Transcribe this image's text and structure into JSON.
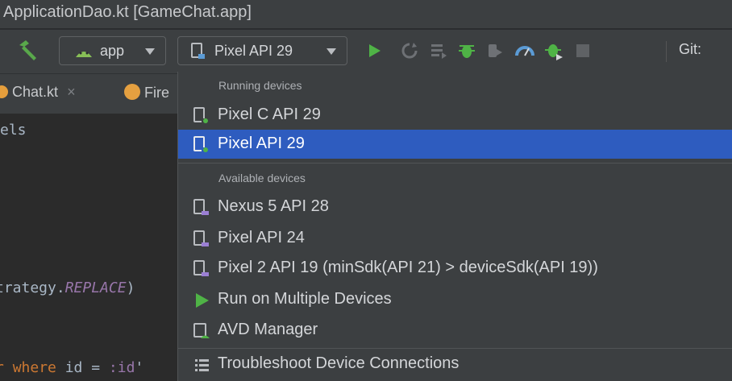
{
  "window": {
    "title": "ApplicationDao.kt [GameChat.app]"
  },
  "toolbar": {
    "build_icon": "hammer-icon",
    "app_config": "app",
    "device_selector": "Pixel API 29",
    "git_label": "Git:",
    "icons": [
      "run-icon",
      "apply-changes-icon",
      "apply-code-changes-icon",
      "debug-icon",
      "attach-debugger-icon",
      "profile-icon",
      "attach-process-icon",
      "stop-icon"
    ]
  },
  "tabs": [
    {
      "label": "Chat.kt",
      "close": "×"
    },
    {
      "label": "Fire"
    }
  ],
  "editor": {
    "lines": [
      {
        "text": "els"
      },
      {
        "text": "trategy.",
        "tail_italic": "REPLACE",
        "tail": ")"
      },
      {
        "kw1": "r ",
        "kw2": "where",
        "mid": " id = ",
        "param": ":id",
        "end": "'"
      }
    ]
  },
  "menu": {
    "running_header": "Running devices",
    "running": [
      {
        "label": "Pixel C API 29",
        "icon": "device-running-icon",
        "selected": false
      },
      {
        "label": "Pixel API 29",
        "icon": "device-running-icon",
        "selected": true
      }
    ],
    "available_header": "Available devices",
    "available": [
      {
        "label": "Nexus 5 API 28",
        "icon": "device-icon"
      },
      {
        "label": "Pixel API 24",
        "icon": "device-icon"
      },
      {
        "label": "Pixel 2 API 19 (minSdk(API 21) > deviceSdk(API 19))",
        "icon": "device-icon"
      }
    ],
    "actions": [
      {
        "label": "Run on Multiple Devices",
        "icon": "run-multiple-icon"
      },
      {
        "label": "AVD Manager",
        "icon": "avd-manager-icon"
      },
      {
        "label": "Troubleshoot Device Connections",
        "icon": "troubleshoot-icon"
      }
    ]
  },
  "colors": {
    "accent": "#2e5cbf",
    "run_green": "#4fb346",
    "background": "#3c3f41"
  }
}
